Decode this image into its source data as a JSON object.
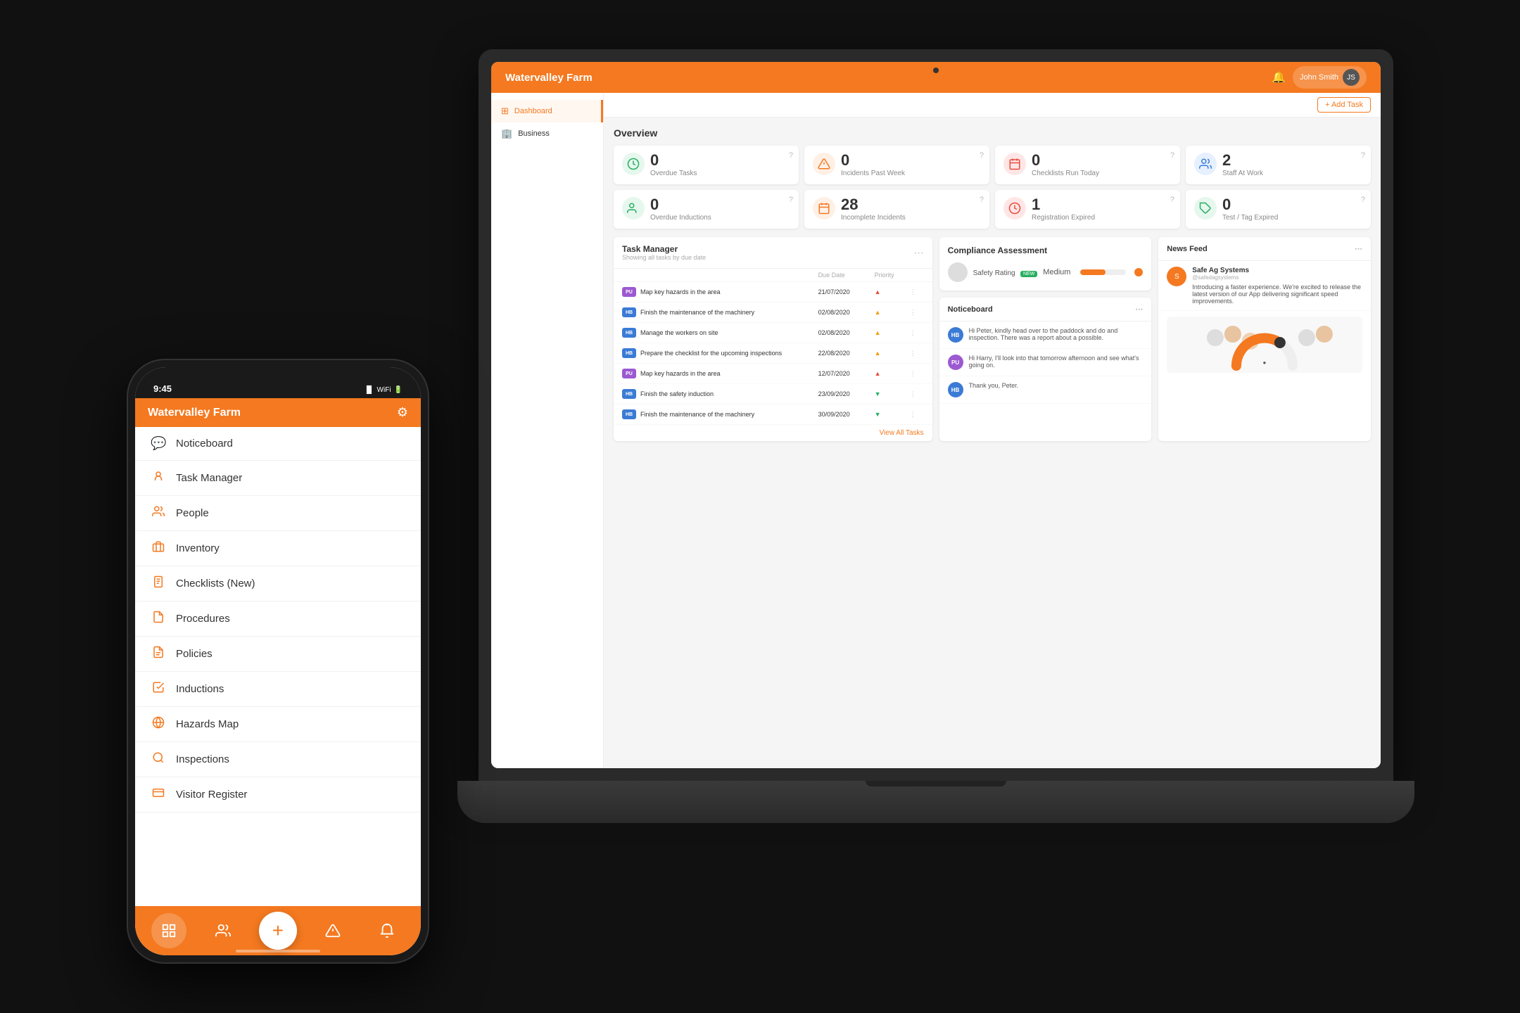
{
  "app": {
    "name": "Watervalley Farm",
    "user": "John Smith"
  },
  "laptop": {
    "topbar": {
      "title": "Watervalley Farm",
      "user": "John Smith",
      "add_task": "+ Add Task"
    },
    "sidebar": {
      "items": [
        {
          "label": "Dashboard",
          "icon": "⊞",
          "active": true
        },
        {
          "label": "Business",
          "icon": "🏢",
          "active": false
        }
      ]
    },
    "overview": {
      "title": "Overview",
      "stats": [
        {
          "num": "0",
          "label": "Overdue Tasks",
          "color": "green"
        },
        {
          "num": "0",
          "label": "Incidents Past Week",
          "color": "orange"
        },
        {
          "num": "0",
          "label": "Checklists Run Today",
          "color": "red"
        },
        {
          "num": "2",
          "label": "Staff At Work",
          "color": "blue"
        },
        {
          "num": "0",
          "label": "Overdue Inductions",
          "color": "green"
        },
        {
          "num": "28",
          "label": "Incomplete Incidents",
          "color": "orange"
        },
        {
          "num": "1",
          "label": "Registration Expired",
          "color": "red"
        },
        {
          "num": "0",
          "label": "Test / Tag Expired",
          "color": "green"
        }
      ]
    },
    "task_manager": {
      "title": "Task Manager",
      "subtitle": "Showing all tasks by due date",
      "cols": [
        "",
        "Due Date",
        "Priority",
        ""
      ],
      "tasks": [
        {
          "badge": "PU",
          "badge_class": "badge-pu",
          "name": "Map key hazards in the area",
          "due": "21/07/2020",
          "priority": "high"
        },
        {
          "badge": "HB",
          "badge_class": "badge-hb",
          "name": "Finish the maintenance of the machinery",
          "due": "02/08/2020",
          "priority": "mid"
        },
        {
          "badge": "HB",
          "badge_class": "badge-hb",
          "name": "Manage the workers on site",
          "due": "02/08/2020",
          "priority": "mid"
        },
        {
          "badge": "HB",
          "badge_class": "badge-hb",
          "name": "Prepare the checklist for the upcoming inspections",
          "due": "22/08/2020",
          "priority": "mid"
        },
        {
          "badge": "PU",
          "badge_class": "badge-pu",
          "name": "Map key hazards in the area",
          "due": "12/07/2020",
          "priority": "high"
        },
        {
          "badge": "HB",
          "badge_class": "badge-hb",
          "name": "Finish the safety induction",
          "due": "23/09/2020",
          "priority": "low"
        },
        {
          "badge": "HB",
          "badge_class": "badge-hb",
          "name": "Finish the maintenance of the machinery",
          "due": "30/09/2020",
          "priority": "low"
        }
      ],
      "view_all": "View All Tasks"
    },
    "compliance": {
      "title": "Compliance Assessment",
      "rating_label": "Safety Rating",
      "new_badge": "NEW",
      "value": "Medium",
      "progress": 55
    },
    "noticeboard": {
      "title": "Noticeboard",
      "messages": [
        {
          "initials": "HB",
          "color": "#3a7bd5",
          "text": "Hi Peter, kindly head over to the paddock and do and inspection. There was a report about a possible."
        },
        {
          "initials": "PU",
          "color": "#9c59d1",
          "text": "Hi Harry, I'll look into that tomorrow afternoon and see what's going on."
        },
        {
          "initials": "HB",
          "color": "#3a7bd5",
          "text": "Thank you, Peter."
        }
      ]
    },
    "newsfeed": {
      "title": "News Feed",
      "author": "Safe Ag Systems",
      "handle": "@safedagsystems",
      "text": "Introducing a faster experience. We're excited to release the latest version of our App delivering significant speed improvements."
    }
  },
  "phone": {
    "status_time": "9:45",
    "header_title": "Watervalley Farm",
    "nav_items": [
      {
        "label": "Noticeboard",
        "icon": "💬"
      },
      {
        "label": "Task Manager",
        "icon": "👤"
      },
      {
        "label": "People",
        "icon": "👥"
      },
      {
        "label": "Inventory",
        "icon": "🗄"
      },
      {
        "label": "Checklists (New)",
        "icon": "📋"
      },
      {
        "label": "Procedures",
        "icon": "📄"
      },
      {
        "label": "Policies",
        "icon": "📑"
      },
      {
        "label": "Inductions",
        "icon": "✅"
      },
      {
        "label": "Hazards Map",
        "icon": "🌐"
      },
      {
        "label": "Inspections",
        "icon": "🔍"
      },
      {
        "label": "Visitor Register",
        "icon": "🪪"
      }
    ],
    "bottom_tabs": [
      {
        "icon": "⊞",
        "label": "home"
      },
      {
        "icon": "👥",
        "label": "people"
      },
      {
        "icon": "+",
        "label": "add"
      },
      {
        "icon": "⚠",
        "label": "hazard"
      },
      {
        "icon": "🔔",
        "label": "alert"
      }
    ]
  }
}
